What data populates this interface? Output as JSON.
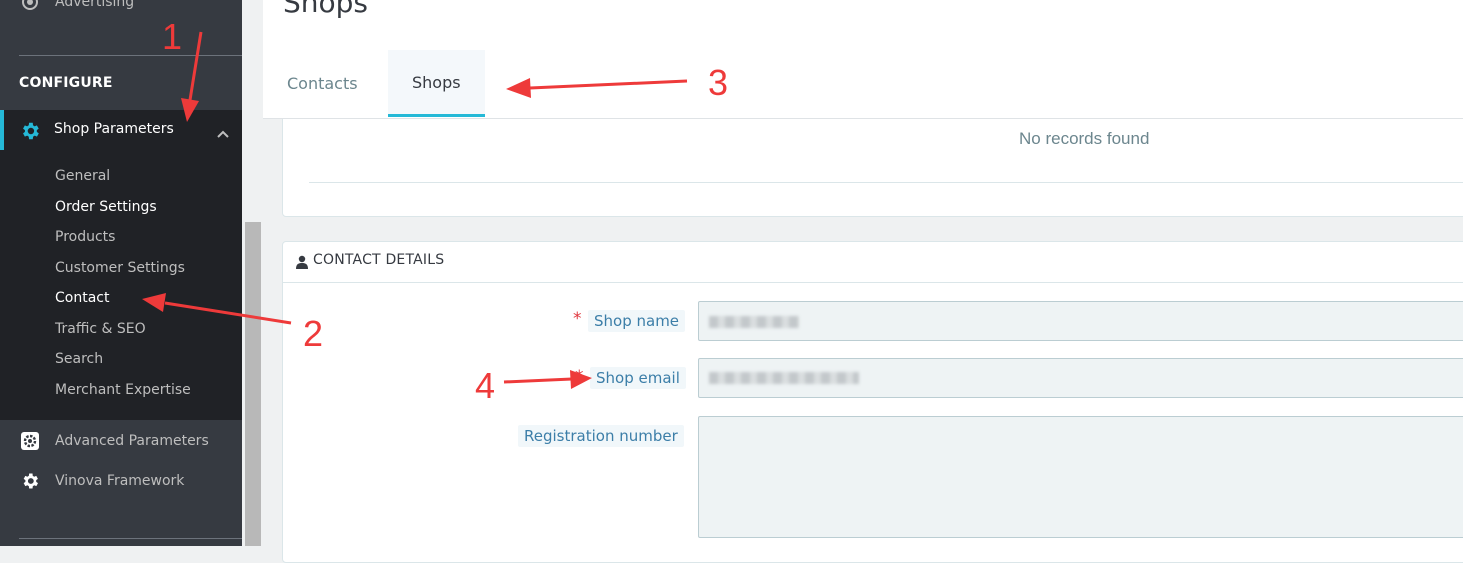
{
  "sidebar": {
    "partial_item": "Advertising",
    "section_title": "CONFIGURE",
    "active_item": "Shop Parameters",
    "submenu": [
      "General",
      "Order Settings",
      "Products",
      "Customer Settings",
      "Contact",
      "Traffic & SEO",
      "Search",
      "Merchant Expertise"
    ],
    "items_below": [
      "Advanced Parameters",
      "Vinova Framework"
    ]
  },
  "page": {
    "title": "Shops"
  },
  "tabs": [
    "Contacts",
    "Shops"
  ],
  "table": {
    "empty_text": "No records found"
  },
  "contact_details": {
    "title": "CONTACT DETAILS",
    "fields": [
      {
        "label": "Shop name",
        "required": "*"
      },
      {
        "label": "Shop email",
        "required": "*"
      },
      {
        "label": "Registration number"
      }
    ]
  },
  "annotations": [
    "1",
    "2",
    "3",
    "4"
  ],
  "colors": {
    "accent": "#25b9d7",
    "annotation": "#ee3a3a",
    "sidebar": "#363a41"
  }
}
